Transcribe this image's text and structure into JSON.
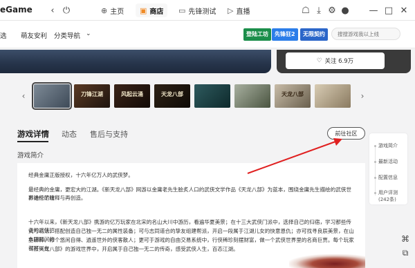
{
  "titlebar": {
    "brand": "eGame",
    "back_icon": "chevron-left-icon",
    "refresh_icon": "power-icon",
    "nav": [
      {
        "label": "主页",
        "icon": "gamepad-icon"
      },
      {
        "label": "商店",
        "icon": "store-bag-icon"
      },
      {
        "label": "先锋测试",
        "icon": "monitor-icon"
      },
      {
        "label": "直播",
        "icon": "play-icon"
      }
    ],
    "window_controls": [
      "minimize-icon",
      "maximize-icon",
      "close-icon"
    ]
  },
  "subnav": {
    "items": [
      "选",
      "萌友安利",
      "分类导航"
    ],
    "badges": [
      {
        "label": "登陆工坊",
        "color": "#1b8e4a"
      },
      {
        "label": "先锋狂2",
        "color": "#2b7de9"
      },
      {
        "label": "无限契约",
        "color": "#2b66c9"
      }
    ],
    "search_placeholder": "搜搜游戏我以上线"
  },
  "follow": {
    "label": "关注 6.9万"
  },
  "thumbnails": [
    {
      "title": "",
      "color": "#5b6a7a"
    },
    {
      "title": "刀锋江湖",
      "color": "#3a2a20"
    },
    {
      "title": "风起云涌",
      "color": "#2a1a14"
    },
    {
      "title": "天龙八部",
      "color": "#241a12"
    },
    {
      "title": "",
      "color": "#1f3a3a"
    },
    {
      "title": "",
      "color": "#6a7560"
    },
    {
      "title": "天龙八部",
      "color": "#8a8070"
    },
    {
      "title": "",
      "color": "#b8a890"
    }
  ],
  "tabs": [
    "游戏详情",
    "动态",
    "售后与支持"
  ],
  "community_button": "前往社区",
  "section_label": "游戏简介",
  "content": {
    "p1": "经典金庸正版授权，十六年亿万人的武侠梦。",
    "p2_line1": "最经典的金庸，更宏大的江湖。《新天龙八部》网游以金庸老先生脍炙人口的武侠文学作品《天龙八部》为蓝本，围绕金庸先生描绘的武侠世界进行了精",
    "p2_line2": "彩绝伦的诠释与再创造。",
    "p3_line1": "十六年以来，《新天龙八部》携游的亿万玩家在北宋的名山大川中游历，看遍华夏美景；在十三大武侠门派中，选择自己的归宿，学习那些传奇的武侠招",
    "p3_line2": "式与功法，搭配创造自己独一无二的属性装备；可与志同道合的挚友组建帮派，开启一段属于江湖儿女的快意恩仇；亦可找寻良辰美景，在山水田园间的",
    "p3_line3": "鱼耕种，修个悠闲自得、逍遥世外的侠客散人；更可于游戏的自由交易系统中，行侠稀珍刻摆财富，做一个武侠世界里的名商巨贾。每个玩家都可以在",
    "p3_line4": "《新天龙八部》的游戏世界中，开启属于自己独一无二的传奇，感受武侠人生，百态江湖。"
  },
  "sidenav": [
    "游戏简介",
    "最新活动",
    "配置信息",
    "用户评测",
    "(242条)"
  ]
}
